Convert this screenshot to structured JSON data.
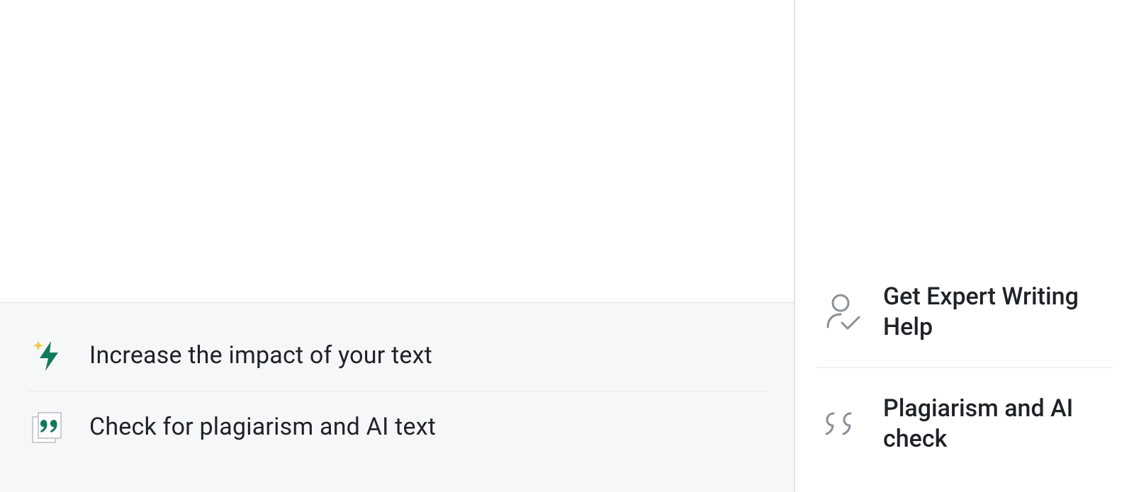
{
  "suggestions": {
    "items": [
      {
        "label": "Increase the impact of your text"
      },
      {
        "label": "Check for plagiarism and AI text"
      }
    ]
  },
  "sidebar": {
    "items": [
      {
        "label": "Get Expert Writing Help"
      },
      {
        "label": "Plagiarism and AI check"
      }
    ]
  },
  "colors": {
    "accent_green": "#0f7a5a",
    "accent_gold": "#f5c84c",
    "icon_gray": "#8a8f98"
  }
}
